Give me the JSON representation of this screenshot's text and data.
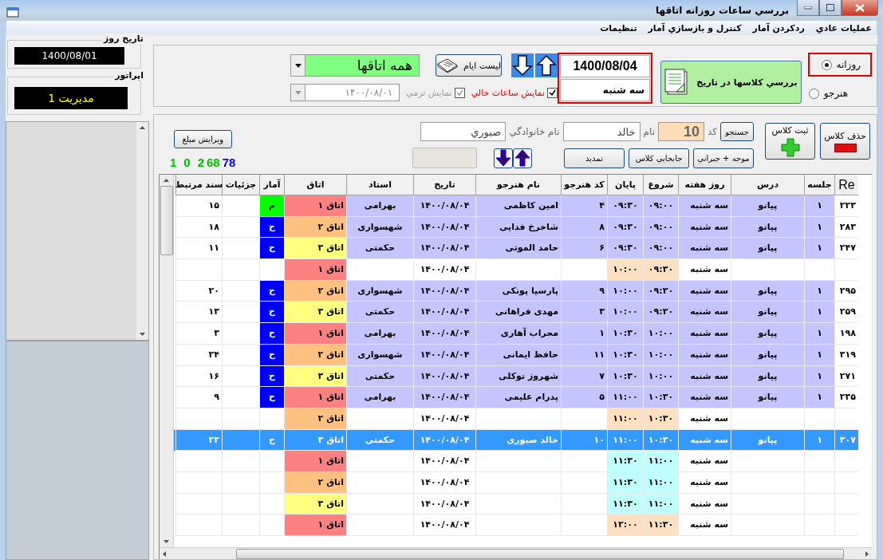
{
  "window": {
    "title": "بررسي ساعات روزانه اتاقها"
  },
  "menu": [
    "عملیات عادي",
    "ردکردن آمار",
    "کنترل و بازسازي آمار",
    "تنظیمات"
  ],
  "sidebar": {
    "date_label": "تاریخ روز",
    "date": "1400/08/01",
    "operator_label": "اپراتور",
    "operator": "مدیریت 1"
  },
  "view_options": [
    {
      "label": "روزانه",
      "selected": true
    },
    {
      "label": "هنرجو",
      "selected": false
    }
  ],
  "review_button": "بررسي کلاسها در تاریخ",
  "current_date": "1400/08/04",
  "weekday": "سه شنبه",
  "list_button": "لیست ایام",
  "room_filter": "همه اتاقها",
  "show_empty": {
    "label": "نمایش ساعات خالي",
    "checked": true
  },
  "term_view": {
    "label": "نمایش ترمي",
    "checked": true,
    "disabled": true
  },
  "term_date": "۱۴۰۰/۰۸/۰۱",
  "delete_button": "حذف کلاس",
  "add_button": "ثبت کلاس",
  "search": {
    "button": "جستجو",
    "code_label": "کد",
    "code": "10",
    "name_label": "نام",
    "name": "خالد",
    "family_label": "نام خانوادگي",
    "family": "صبوري"
  },
  "buttons": [
    "موجه + جبراني",
    "جابجایي کلاس",
    "تمدید"
  ],
  "edit_amount": "ویرایش مبلغ",
  "counts": [
    {
      "text": "78",
      "color": "#0000ff"
    },
    {
      "text": "68",
      "color": "#00c000"
    },
    {
      "text": "2",
      "color": "#00c000"
    },
    {
      "text": "0",
      "color": "#00c000"
    },
    {
      "text": "1",
      "color": "#00c000"
    }
  ],
  "table": {
    "columns": [
      "Re",
      "جلسه",
      "درس",
      "روز هفته",
      "شروع",
      "پایان",
      "کد هنرجو",
      "نام هنرجو",
      "تاریخ",
      "استاد",
      "اتاق",
      "آمار",
      "جزئیات",
      "سند مرتبط"
    ],
    "rows": [
      {
        "kind": "lesson",
        "selected": false,
        "re": "۲۲۳",
        "session": "۱",
        "course": "پیانو",
        "weekday": "سه شنبه",
        "start": "۰۹:۰۰",
        "end": "۰۹:۳۰",
        "student_code": "۴",
        "student_name": "امین کاظمی",
        "date": "۱۴۰۰/۰۸/۰۴",
        "teacher": "بهرامی",
        "room": {
          "text": "اتاق ۱",
          "color": "#ff8080"
        },
        "stats": {
          "text": "م",
          "color": "#00ff00"
        },
        "document": "۱۵"
      },
      {
        "kind": "lesson",
        "selected": false,
        "re": "۲۸۳",
        "session": "۱",
        "course": "پیانو",
        "weekday": "سه شنبه",
        "start": "۰۹:۰۰",
        "end": "۰۹:۳۰",
        "student_code": "۸",
        "student_name": "شاخرخ فدایی",
        "date": "۱۴۰۰/۰۸/۰۴",
        "teacher": "شهسواری",
        "room": {
          "text": "اتاق ۲",
          "color": "#ffc080"
        },
        "stats": {
          "text": "ح",
          "color": "#0000ff"
        },
        "document": "۱۸"
      },
      {
        "kind": "lesson",
        "selected": false,
        "re": "۲۴۷",
        "session": "۱",
        "course": "پیانو",
        "weekday": "سه شنبه",
        "start": "۰۹:۰۰",
        "end": "۰۹:۳۰",
        "student_code": "۶",
        "student_name": "حامد الموتی",
        "date": "۱۴۰۰/۰۸/۰۴",
        "teacher": "حکمتی",
        "room": {
          "text": "اتاق ۳",
          "color": "#ffff80"
        },
        "stats": {
          "text": "ح",
          "color": "#0000ff"
        },
        "document": "۱۱"
      },
      {
        "kind": "free",
        "selected": false,
        "weekday": "سه شنبه",
        "start": {
          "text": "۰۹:۳۰",
          "color": "#ffe0c0"
        },
        "end": {
          "text": "۱۰:۰۰",
          "color": "#ffe0c0"
        },
        "date": "۱۴۰۰/۰۸/۰۴",
        "room": {
          "text": "اتاق ۱",
          "color": "#ff8080"
        }
      },
      {
        "kind": "lesson",
        "selected": false,
        "re": "۲۹۵",
        "session": "۱",
        "course": "پیانو",
        "weekday": "سه شنبه",
        "start": "۰۹:۳۰",
        "end": "۱۰:۰۰",
        "student_code": "۹",
        "student_name": "پارسیا پونکی",
        "date": "۱۴۰۰/۰۸/۰۴",
        "teacher": "شهسواری",
        "room": {
          "text": "اتاق ۲",
          "color": "#ffc080"
        },
        "stats": {
          "text": "ح",
          "color": "#0000ff"
        },
        "document": "۲۰"
      },
      {
        "kind": "lesson",
        "selected": false,
        "re": "۲۵۹",
        "session": "۱",
        "course": "پیانو",
        "weekday": "سه شنبه",
        "start": "۰۹:۳۰",
        "end": "۱۰:۰۰",
        "student_code": "۳",
        "student_name": "مهدی فراهانی",
        "date": "۱۴۰۰/۰۸/۰۴",
        "teacher": "حکمتی",
        "room": {
          "text": "اتاق ۳",
          "color": "#ffff80"
        },
        "stats": {
          "text": "ح",
          "color": "#0000ff"
        },
        "document": "۱۳"
      },
      {
        "kind": "lesson",
        "selected": false,
        "re": "۱۹۸",
        "session": "۱",
        "course": "پیانو",
        "weekday": "سه شنبه",
        "start": "۱۰:۰۰",
        "end": "۱۰:۳۰",
        "student_code": "۱",
        "student_name": "محراب آهاری",
        "date": "۱۴۰۰/۰۸/۰۴",
        "teacher": "بهرامی",
        "room": {
          "text": "اتاق ۱",
          "color": "#ff8080"
        },
        "stats": {
          "text": "ح",
          "color": "#0000ff"
        },
        "document": "۳"
      },
      {
        "kind": "lesson",
        "selected": false,
        "re": "۳۱۹",
        "session": "۱",
        "course": "پیانو",
        "weekday": "سه شنبه",
        "start": "۱۰:۰۰",
        "end": "۱۰:۳۰",
        "student_code": "۱۱",
        "student_name": "حافظ ایمانی",
        "date": "۱۴۰۰/۰۸/۰۴",
        "teacher": "شهسواری",
        "room": {
          "text": "اتاق ۲",
          "color": "#ffc080"
        },
        "stats": {
          "text": "ح",
          "color": "#0000ff"
        },
        "document": "۲۴"
      },
      {
        "kind": "lesson",
        "selected": false,
        "re": "۲۷۱",
        "session": "۱",
        "course": "پیانو",
        "weekday": "سه شنبه",
        "start": "۱۰:۰۰",
        "end": "۱۰:۳۰",
        "student_code": "۷",
        "student_name": "شهروز توکلی",
        "date": "۱۴۰۰/۰۸/۰۴",
        "teacher": "حکمتی",
        "room": {
          "text": "اتاق ۳",
          "color": "#ffff80"
        },
        "stats": {
          "text": "ح",
          "color": "#0000ff"
        },
        "document": "۱۶"
      },
      {
        "kind": "lesson",
        "selected": false,
        "re": "۲۳۵",
        "session": "۱",
        "course": "پیانو",
        "weekday": "سه شنبه",
        "start": "۱۰:۳۰",
        "end": "۱۱:۰۰",
        "student_code": "۵",
        "student_name": "پدرام علیمی",
        "date": "۱۴۰۰/۰۸/۰۴",
        "teacher": "بهرامی",
        "room": {
          "text": "اتاق ۱",
          "color": "#ff8080"
        },
        "stats": {
          "text": "ح",
          "color": "#0000ff"
        },
        "document": "۹"
      },
      {
        "kind": "free",
        "selected": false,
        "weekday": "سه شنبه",
        "start": {
          "text": "۱۰:۳۰",
          "color": "#ffe0c0"
        },
        "end": {
          "text": "۱۱:۰۰",
          "color": "#ffe0c0"
        },
        "date": "۱۴۰۰/۰۸/۰۴",
        "room": {
          "text": "اتاق ۲",
          "color": "#ffc080"
        }
      },
      {
        "kind": "lesson",
        "selected": true,
        "re": "۳۰۷",
        "session": "۱",
        "course": "پیانو",
        "weekday": "سه شنبه",
        "start": "۱۰:۳۰",
        "end": "۱۱:۰۰",
        "student_code": "۱۰",
        "student_name": "خالد صبوری",
        "date": "۱۴۰۰/۰۸/۰۴",
        "teacher": "حکمتی",
        "room": "اتاق ۳",
        "stats": "ح",
        "document": "۲۲"
      },
      {
        "kind": "free",
        "selected": false,
        "weekday": "سه شنبه",
        "start": {
          "text": "۱۱:۰۰",
          "color": "#c0ffff"
        },
        "end": {
          "text": "۱۱:۳۰",
          "color": "#c0ffff"
        },
        "date": "۱۴۰۰/۰۸/۰۴",
        "room": {
          "text": "اتاق ۱",
          "color": "#ff8080"
        }
      },
      {
        "kind": "free",
        "selected": false,
        "weekday": "سه شنبه",
        "start": {
          "text": "۱۱:۰۰",
          "color": "#c0ffff"
        },
        "end": {
          "text": "۱۱:۳۰",
          "color": "#c0ffff"
        },
        "date": "۱۴۰۰/۰۸/۰۴",
        "room": {
          "text": "اتاق ۲",
          "color": "#ffc080"
        }
      },
      {
        "kind": "free",
        "selected": false,
        "weekday": "سه شنبه",
        "start": {
          "text": "۱۱:۰۰",
          "color": "#c0ffff"
        },
        "end": {
          "text": "۱۱:۳۰",
          "color": "#c0ffff"
        },
        "date": "۱۴۰۰/۰۸/۰۴",
        "room": {
          "text": "اتاق ۳",
          "color": "#ffff80"
        }
      },
      {
        "kind": "free",
        "selected": false,
        "weekday": "سه شنبه",
        "start": {
          "text": "۱۱:۳۰",
          "color": "#ffe0c0"
        },
        "end": {
          "text": "۱۲:۰۰",
          "color": "#ffe0c0"
        },
        "date": "۱۴۰۰/۰۸/۰۴",
        "room": {
          "text": "اتاق ۱",
          "color": "#ff8080"
        }
      }
    ]
  }
}
